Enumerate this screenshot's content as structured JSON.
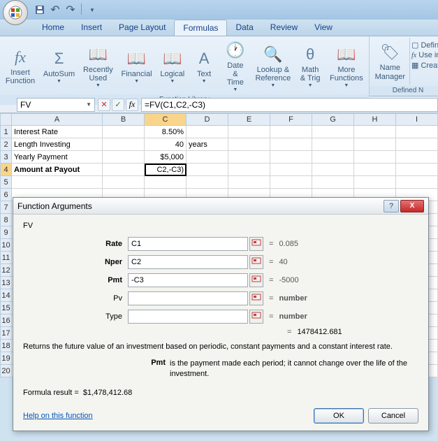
{
  "qat_icons": [
    "save-icon",
    "undo-icon",
    "redo-icon"
  ],
  "tabs": {
    "home": "Home",
    "insert": "Insert",
    "page_layout": "Page Layout",
    "formulas": "Formulas",
    "data": "Data",
    "review": "Review",
    "view": "View"
  },
  "active_tab": "formulas",
  "ribbon": {
    "insert_function": "Insert\nFunction",
    "autosum": "AutoSum",
    "recently_used": "Recently\nUsed",
    "financial": "Financial",
    "logical": "Logical",
    "text": "Text",
    "date_time": "Date &\nTime",
    "lookup_ref": "Lookup &\nReference",
    "math_trig": "Math\n& Trig",
    "more_functions": "More\nFunctions",
    "group_label": "Function Library",
    "name_manager": "Name\nManager",
    "define_name": "Defin",
    "use_in": "Use in",
    "create": "Create",
    "defined_label": "Defined N"
  },
  "namebox": "FV",
  "formula": "=FV(C1,C2,-C3)",
  "columns": [
    "A",
    "B",
    "C",
    "D",
    "E",
    "F",
    "G",
    "H",
    "I"
  ],
  "active_col": "C",
  "active_row": 4,
  "cells": {
    "r1": {
      "a": "Interest Rate",
      "c": "8.50%"
    },
    "r2": {
      "a": "Length Investing",
      "c": "40",
      "d": "years"
    },
    "r3": {
      "a": "Yearly Payment",
      "c": "$5,000"
    },
    "r4": {
      "a": "Amount at Payout",
      "c": "C2,-C3)"
    }
  },
  "dialog": {
    "title": "Function Arguments",
    "fn": "FV",
    "args": [
      {
        "label": "Rate",
        "bold": true,
        "value": "C1",
        "result": "0.085"
      },
      {
        "label": "Nper",
        "bold": true,
        "value": "C2",
        "result": "40"
      },
      {
        "label": "Pmt",
        "bold": true,
        "value": "-C3",
        "result": "-5000"
      },
      {
        "label": "Pv",
        "bold": false,
        "value": "",
        "result": "number",
        "gray": true
      },
      {
        "label": "Type",
        "bold": false,
        "value": "",
        "result": "number",
        "gray": true
      }
    ],
    "calc_result": "1478412.681",
    "description": "Returns the future value of an investment based on periodic, constant payments and a constant interest rate.",
    "param_name": "Pmt",
    "param_desc": "is the payment made each period; it cannot change over the life of the investment.",
    "formula_result_label": "Formula result =",
    "formula_result": "$1,478,412.68",
    "help_link": "Help on this function",
    "ok": "OK",
    "cancel": "Cancel"
  }
}
